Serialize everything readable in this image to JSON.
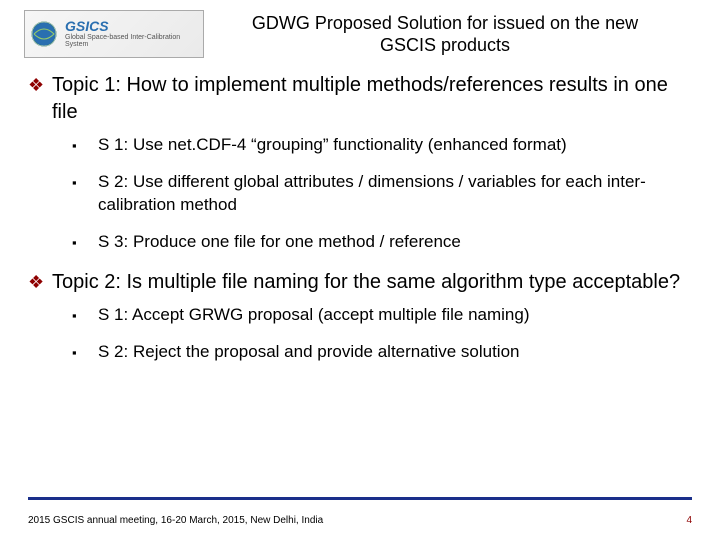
{
  "logo": {
    "name": "GSICS",
    "tagline": "Global Space-based Inter-Calibration System"
  },
  "title": "GDWG Proposed Solution for issued on the new GSCIS products",
  "topics": [
    {
      "heading": "Topic 1: How to implement multiple methods/references results in one file",
      "subs": [
        "S 1: Use net.CDF-4 “grouping” functionality (enhanced format)",
        "S 2: Use different global attributes / dimensions / variables for each inter-calibration method",
        "S 3: Produce one file for one method / reference"
      ]
    },
    {
      "heading": "Topic 2: Is multiple file naming for the same algorithm type acceptable?",
      "subs": [
        "S 1: Accept GRWG proposal (accept multiple file naming)",
        "S 2: Reject the proposal and provide alternative solution"
      ]
    }
  ],
  "footer": "2015 GSCIS annual meeting, 16-20 March, 2015, New Delhi, India",
  "page_number": "4"
}
